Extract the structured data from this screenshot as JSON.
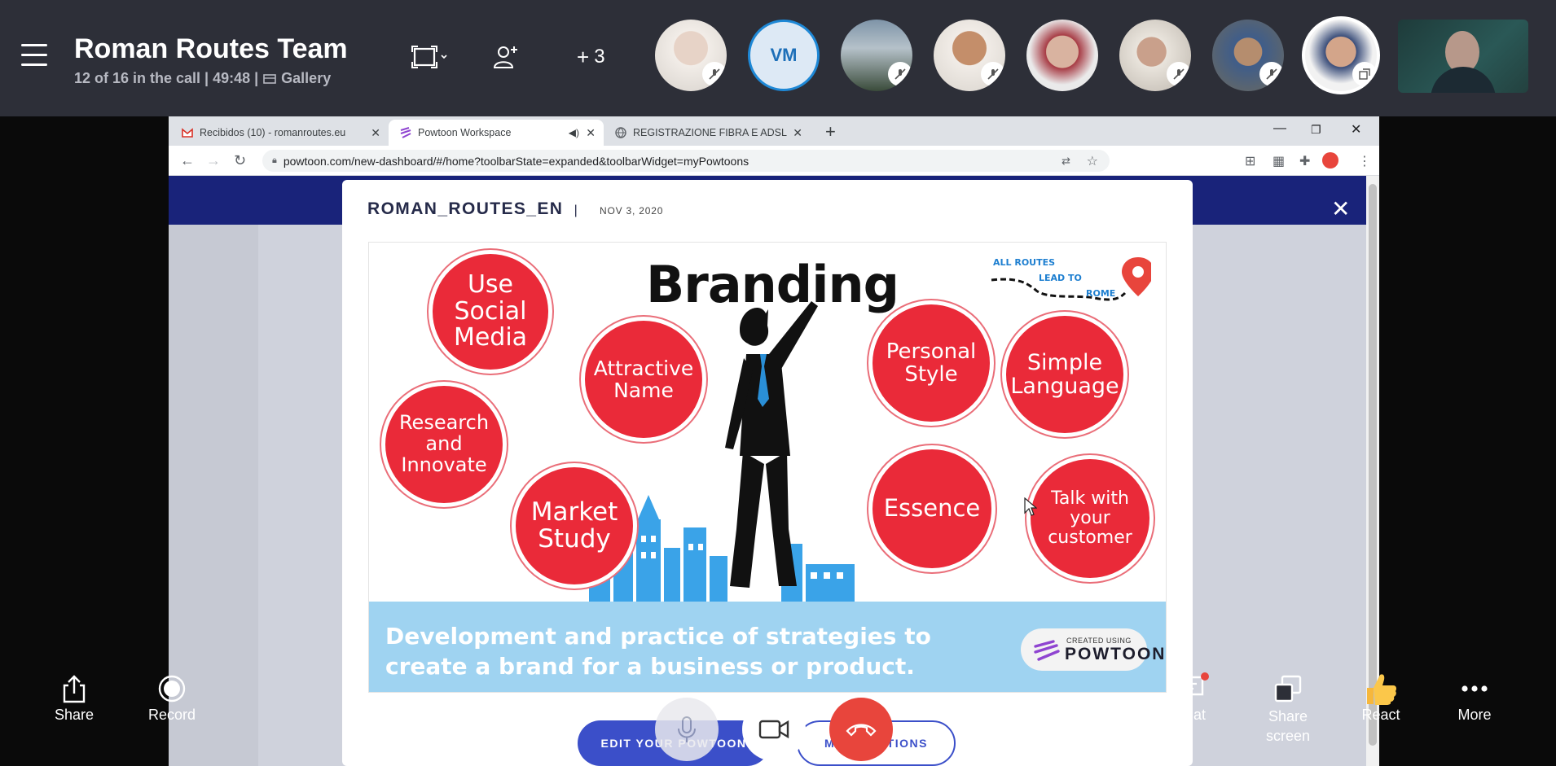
{
  "call": {
    "title": "Roman Routes Team",
    "status": "12 of 16 in the call | 49:48 |",
    "view_label": "Gallery",
    "extra_count": "3",
    "avatar_initials": "VM"
  },
  "browser": {
    "tabs": [
      {
        "label": "Recibidos (10) - romanroutes.eu"
      },
      {
        "label": "Powtoon Workspace"
      },
      {
        "label": "REGISTRAZIONE FIBRA E ADSL"
      }
    ],
    "url": "powtoon.com/new-dashboard/#/home?toolbarState=expanded&toolbarWidget=myPowtoons"
  },
  "modal": {
    "title": "ROMAN_ROUTES_EN",
    "separator": "|",
    "date": "NOV 3, 2020",
    "edit_button": "EDIT YOUR POWTOON",
    "more_button": "MORE OPTIONS"
  },
  "slide": {
    "title": "Branding",
    "bubbles": [
      "Use Social Media",
      "Attractive Name",
      "Research and Innovate",
      "Market Study",
      "Personal Style",
      "Simple Language",
      "Essence",
      "Talk with your customer"
    ],
    "logo_line1": "ALL ROUTES",
    "logo_line2": "LEAD TO",
    "logo_line3": "ROME",
    "banner_line1": "Development and practice of strategies to",
    "banner_line2": "create a brand for a business or product.",
    "badge_small": "CREATED USING",
    "badge_name": "POWTOON"
  },
  "controls": {
    "share": "Share",
    "record": "Record",
    "chat": "Chat",
    "share_screen": "Share screen",
    "react": "React",
    "more": "More"
  },
  "colors": {
    "header_bg": "#2d2f38",
    "bubble_red": "#ea2a39",
    "banner_blue": "#9fd3f1",
    "end_call": "#e8453c"
  }
}
